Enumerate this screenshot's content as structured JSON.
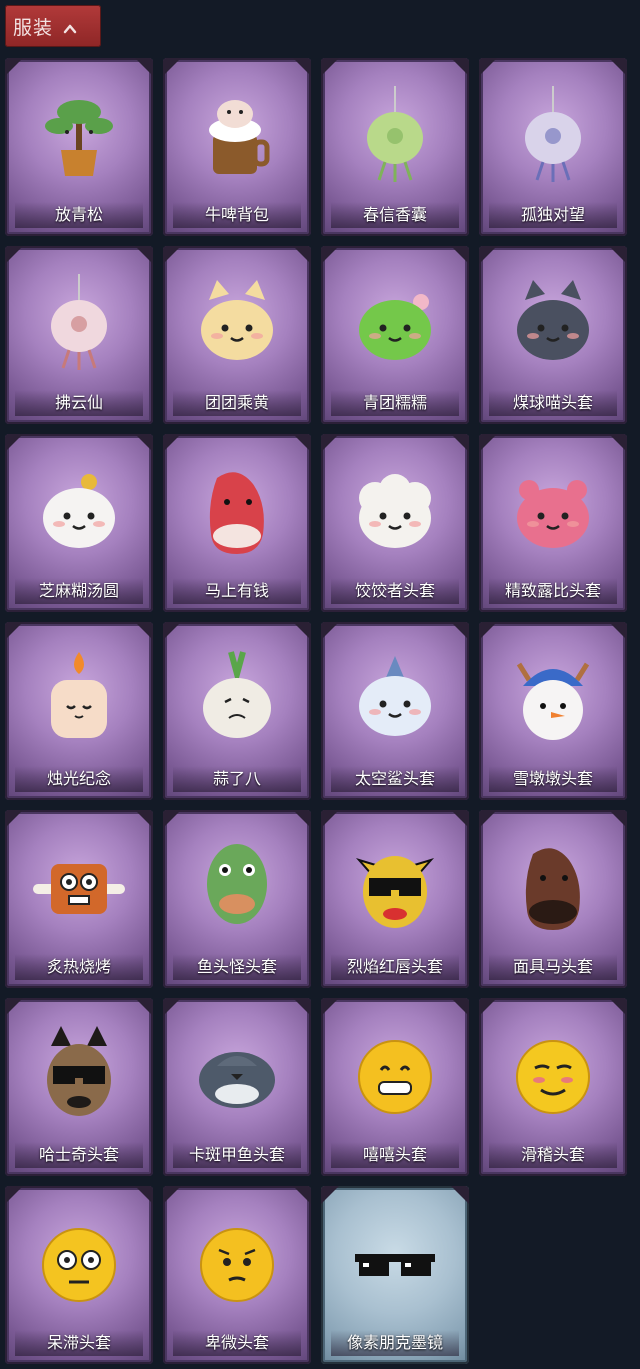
{
  "header": {
    "title": "服装",
    "chevron_icon": "chevron-up-icon",
    "accent_color": "#a53030"
  },
  "items": [
    {
      "label": "放青松",
      "icon": "pine-bonsai-icon",
      "color": "#5aa04a",
      "accent": "#c8812e"
    },
    {
      "label": "牛啤背包",
      "icon": "cow-beer-mug-icon",
      "color": "#f2ddd5",
      "accent": "#8b5a2b"
    },
    {
      "label": "春信香囊",
      "icon": "sachet-icon",
      "color": "#b9d98a",
      "accent": "#7fb35a"
    },
    {
      "label": "孤独对望",
      "icon": "figure-charm-icon",
      "color": "#d9d3ea",
      "accent": "#6b6fb8"
    },
    {
      "label": "拂云仙",
      "icon": "immortal-charm-icon",
      "color": "#f0d8de",
      "accent": "#c77a7a"
    },
    {
      "label": "团团乘黄",
      "icon": "round-cat-head-icon",
      "color": "#f4dca0",
      "accent": "#d9a85a"
    },
    {
      "label": "青团糯糯",
      "icon": "green-rice-ball-icon",
      "color": "#74c84a",
      "accent": "#f2b8c8"
    },
    {
      "label": "煤球喵头套",
      "icon": "black-cat-head-icon",
      "color": "#4a5060",
      "accent": "#aab2c8"
    },
    {
      "label": "芝麻糊汤圆",
      "icon": "rice-dumpling-icon",
      "color": "#f5f3f2",
      "accent": "#e8b93a"
    },
    {
      "label": "马上有钱",
      "icon": "red-horse-head-icon",
      "color": "#d8424a",
      "accent": "#f4e4e0"
    },
    {
      "label": "饺饺者头套",
      "icon": "dumpling-head-icon",
      "color": "#f4f2ee",
      "accent": "#7fd0e0"
    },
    {
      "label": "精致露比头套",
      "icon": "pink-bear-head-icon",
      "color": "#e8708e",
      "accent": "#7a58a8"
    },
    {
      "label": "烛光纪念",
      "icon": "candle-head-icon",
      "color": "#f6dcc8",
      "accent": "#f28a2a"
    },
    {
      "label": "蒜了八",
      "icon": "garlic-head-icon",
      "color": "#f0ece4",
      "accent": "#5aa64a"
    },
    {
      "label": "太空鲨头套",
      "icon": "shark-head-icon",
      "color": "#e4ecf8",
      "accent": "#6a8ac0"
    },
    {
      "label": "雪墩墩头套",
      "icon": "snowman-head-icon",
      "color": "#f6f4f4",
      "accent": "#3a6ac8"
    },
    {
      "label": "炙热烧烤",
      "icon": "bbq-meat-icon",
      "color": "#d2682a",
      "accent": "#f4efe6"
    },
    {
      "label": "鱼头怪头套",
      "icon": "fish-mask-icon",
      "color": "#6aa85a",
      "accent": "#d89060"
    },
    {
      "label": "烈焰红唇头套",
      "icon": "yellow-mask-sunglasses-icon",
      "color": "#e8c030",
      "accent": "#d83030"
    },
    {
      "label": "面具马头套",
      "icon": "horse-mask-icon",
      "color": "#6a3a2a",
      "accent": "#2a1a14"
    },
    {
      "label": "哈士奇头套",
      "icon": "husky-sunglasses-icon",
      "color": "#8a6a4a",
      "accent": "#1e1a18"
    },
    {
      "label": "卡斑甲鱼头套",
      "icon": "turtle-head-icon",
      "color": "#4e5a6a",
      "accent": "#e8ecef"
    },
    {
      "label": "嘻嘻头套",
      "icon": "grinning-emoji-icon",
      "color": "#f4c020",
      "accent": "#1e1e1e"
    },
    {
      "label": "滑稽头套",
      "icon": "smirk-emoji-icon",
      "color": "#f4c820",
      "accent": "#e87a7a"
    },
    {
      "label": "呆滞头套",
      "icon": "stunned-emoji-icon",
      "color": "#f4c420",
      "accent": "#1e1e1e"
    },
    {
      "label": "卑微头套",
      "icon": "pleading-emoji-icon",
      "color": "#f4c020",
      "accent": "#1e1e1e"
    },
    {
      "label": "像素朋克墨镜",
      "icon": "pixel-sunglasses-icon",
      "color": "#111111",
      "accent": "#ffffff",
      "rarity": "blue"
    }
  ]
}
